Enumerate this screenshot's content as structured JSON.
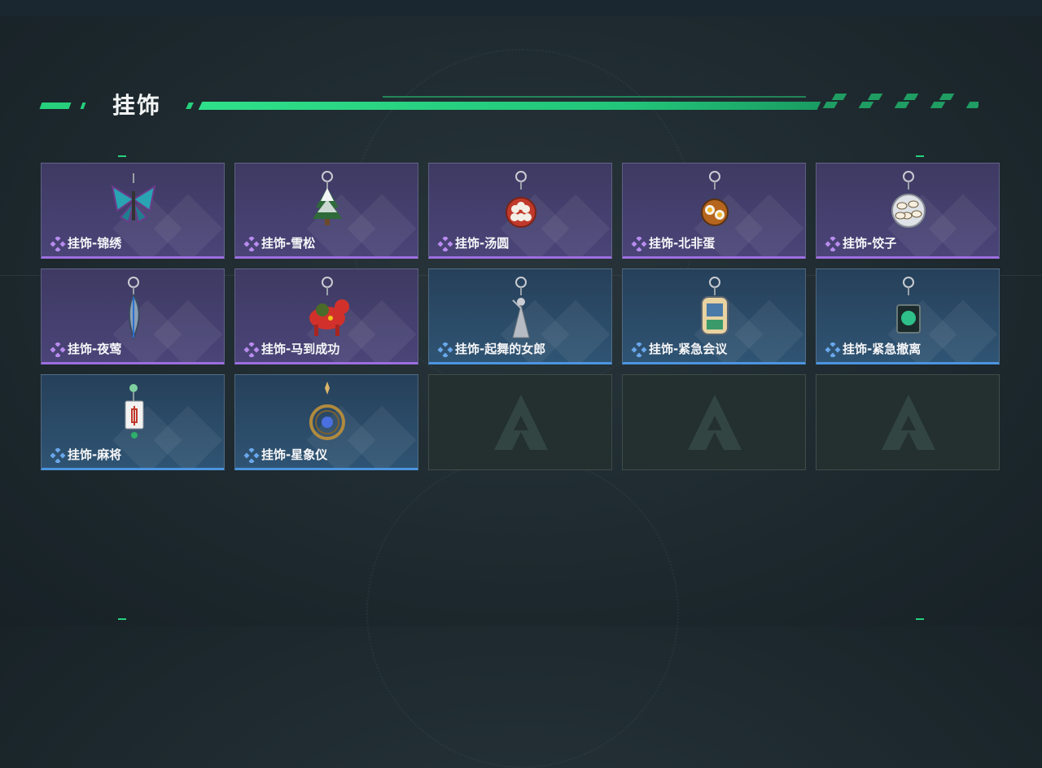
{
  "section": {
    "title": "挂饰"
  },
  "colors": {
    "accent": "#26d07c",
    "purple_rarity": "#9d6ee0",
    "blue_rarity": "#4c94e0"
  },
  "items": [
    {
      "label": "挂饰-锦绣",
      "rarity": "purple",
      "icon": "butterfly-charm-icon"
    },
    {
      "label": "挂饰-雪松",
      "rarity": "purple",
      "icon": "snow-pine-charm-icon"
    },
    {
      "label": "挂饰-汤圆",
      "rarity": "purple",
      "icon": "tangyuan-bowl-charm-icon"
    },
    {
      "label": "挂饰-北非蛋",
      "rarity": "purple",
      "icon": "shakshuka-charm-icon"
    },
    {
      "label": "挂饰-饺子",
      "rarity": "purple",
      "icon": "dumplings-charm-icon"
    },
    {
      "label": "挂饰-夜莺",
      "rarity": "purple",
      "icon": "feather-charm-icon"
    },
    {
      "label": "挂饰-马到成功",
      "rarity": "purple",
      "icon": "red-horse-charm-icon"
    },
    {
      "label": "挂饰-起舞的女郎",
      "rarity": "blue",
      "icon": "dancer-charm-icon"
    },
    {
      "label": "挂饰-紧急会议",
      "rarity": "blue",
      "icon": "meeting-badge-charm-icon"
    },
    {
      "label": "挂饰-紧急撤离",
      "rarity": "blue",
      "icon": "evacuation-tag-charm-icon"
    },
    {
      "label": "挂饰-麻将",
      "rarity": "blue",
      "icon": "mahjong-tile-charm-icon"
    },
    {
      "label": "挂饰-星象仪",
      "rarity": "blue",
      "icon": "astrolabe-charm-icon"
    },
    {
      "label": "",
      "rarity": "empty",
      "icon": "empty-slot-logo-icon"
    },
    {
      "label": "",
      "rarity": "empty",
      "icon": "empty-slot-logo-icon"
    },
    {
      "label": "",
      "rarity": "empty",
      "icon": "empty-slot-logo-icon"
    }
  ]
}
